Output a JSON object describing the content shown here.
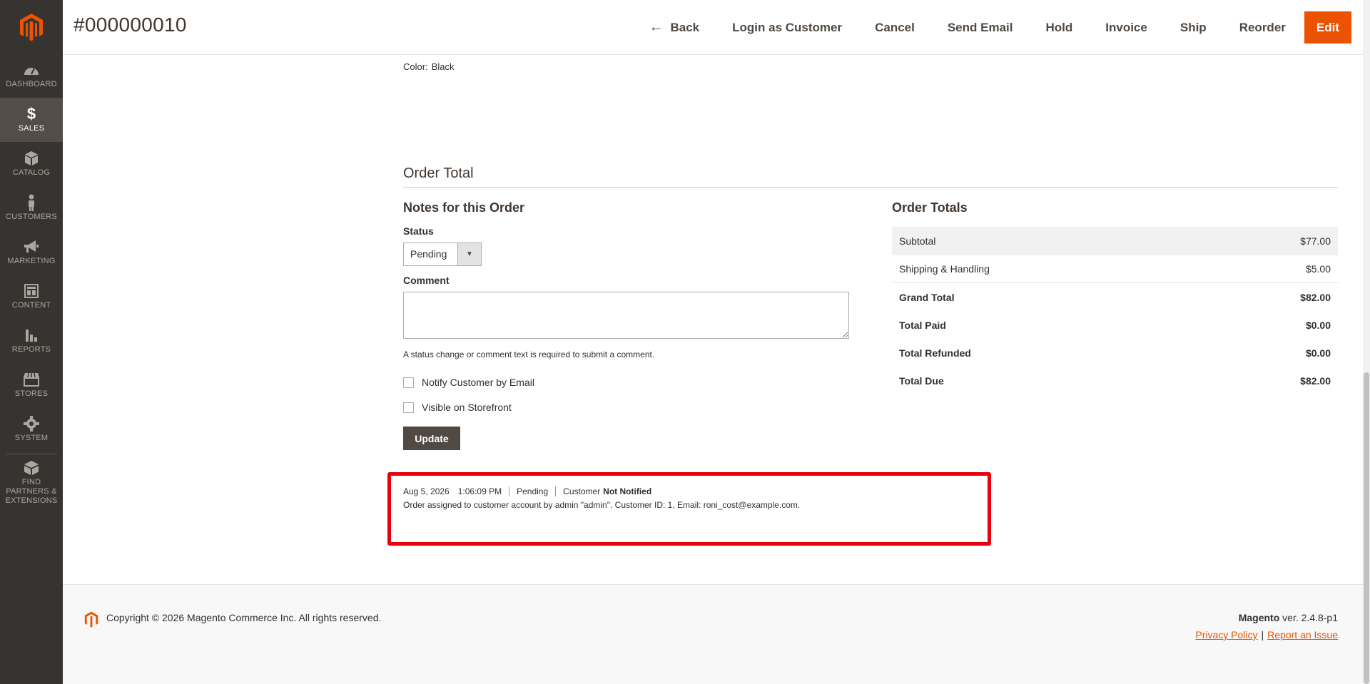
{
  "colors": {
    "sidebar_bg": "#373330",
    "sidebar_active": "#524d49",
    "brand_orange": "#eb5202",
    "highlight_red": "#e8000d",
    "update_button": "#514943"
  },
  "sidebar": {
    "logo_icon": "magento-logo-icon",
    "items": [
      {
        "label": "DASHBOARD",
        "icon": "dashboard-gauge-icon",
        "active": false
      },
      {
        "label": "SALES",
        "icon": "dollar-icon",
        "active": true
      },
      {
        "label": "CATALOG",
        "icon": "box-icon",
        "active": false
      },
      {
        "label": "CUSTOMERS",
        "icon": "person-icon",
        "active": false
      },
      {
        "label": "MARKETING",
        "icon": "megaphone-icon",
        "active": false
      },
      {
        "label": "CONTENT",
        "icon": "layout-icon",
        "active": false
      },
      {
        "label": "REPORTS",
        "icon": "bar-chart-icon",
        "active": false
      },
      {
        "label": "STORES",
        "icon": "storefront-icon",
        "active": false
      },
      {
        "label": "SYSTEM",
        "icon": "gear-icon",
        "active": false
      },
      {
        "label": "FIND PARTNERS & EXTENSIONS",
        "icon": "blocks-icon",
        "active": false
      }
    ]
  },
  "header": {
    "title": "#000000010",
    "actions": {
      "back": "Back",
      "login_as_customer": "Login as Customer",
      "cancel": "Cancel",
      "send_email": "Send Email",
      "hold": "Hold",
      "invoice": "Invoice",
      "ship": "Ship",
      "reorder": "Reorder",
      "edit": "Edit"
    }
  },
  "item_option": {
    "label": "Color:",
    "value": "Black"
  },
  "order_total_section": {
    "title": "Order Total"
  },
  "notes": {
    "title": "Notes for this Order",
    "status_label": "Status",
    "status_value": "Pending",
    "comment_label": "Comment",
    "comment_value": "",
    "help_text": "A status change or comment text is required to submit a comment.",
    "notify_label": "Notify Customer by Email",
    "notify_checked": false,
    "visible_label": "Visible on Storefront",
    "visible_checked": false,
    "update_button": "Update"
  },
  "totals": {
    "title": "Order Totals",
    "rows": [
      {
        "label": "Subtotal",
        "value": "$77.00"
      },
      {
        "label": "Shipping & Handling",
        "value": "$5.00"
      },
      {
        "label": "Grand Total",
        "value": "$82.00"
      },
      {
        "label": "Total Paid",
        "value": "$0.00"
      },
      {
        "label": "Total Refunded",
        "value": "$0.00"
      },
      {
        "label": "Total Due",
        "value": "$82.00"
      }
    ]
  },
  "history": {
    "date": "Aug 5, 2026",
    "time": "1:06:09 PM",
    "status": "Pending",
    "customer_label": "Customer",
    "notified": "Not Notified",
    "comment": "Order assigned to customer account by admin \"admin\". Customer ID: 1, Email: roni_cost@example.com."
  },
  "footer": {
    "copyright": "Copyright © 2026 Magento Commerce Inc. All rights reserved.",
    "brand": "Magento",
    "version": "ver. 2.4.8-p1",
    "privacy_policy": "Privacy Policy",
    "separator": "|",
    "report_issue": "Report an Issue"
  }
}
